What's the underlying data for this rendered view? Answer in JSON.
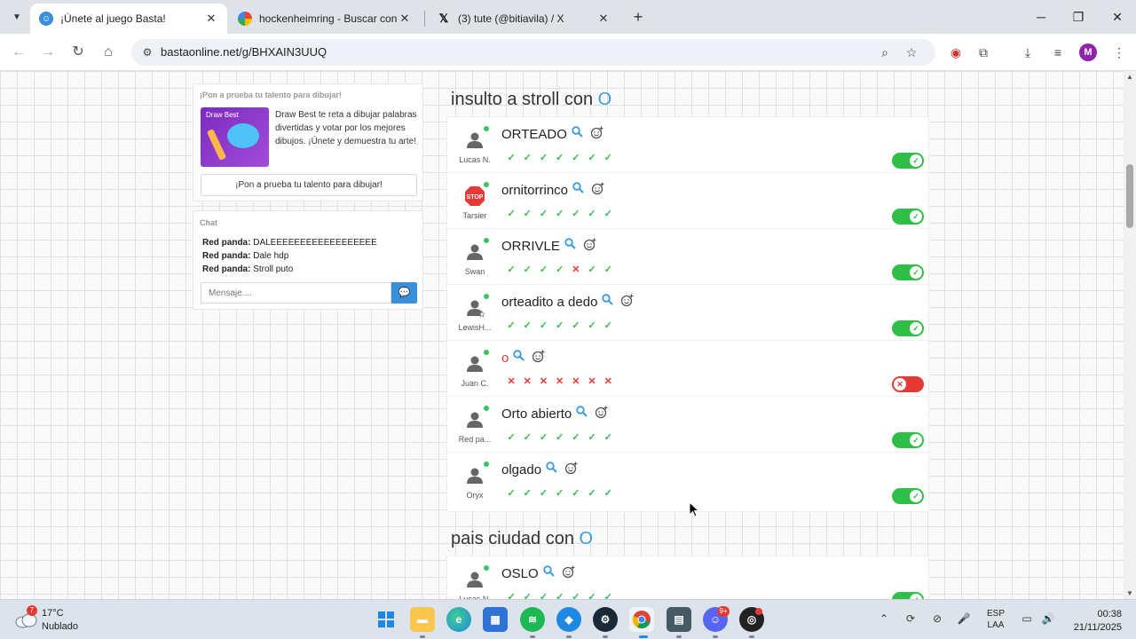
{
  "browser": {
    "tabs": [
      {
        "title": "¡Únete al juego Basta!",
        "favicon": "basta-favicon-icon",
        "active": true
      },
      {
        "title": "hockenheimring - Buscar con G",
        "favicon": "google-icon",
        "active": false
      },
      {
        "title": "(3) tute (@bitiavila) / X",
        "favicon": "x-icon",
        "active": false
      }
    ],
    "url": "bastaonline.net/g/BHXAIN3UUQ",
    "profile_initial": "M"
  },
  "promo": {
    "title": "¡Pon a prueba tu talento para dibujar!",
    "image_label": "Draw Best",
    "description": "Draw Best te reta a dibujar palabras divertidas y votar por los mejores dibujos. ¡Únete y demuestra tu arte!",
    "button_label": "¡Pon a prueba tu talento para dibujar!"
  },
  "chat": {
    "title": "Chat",
    "messages": [
      {
        "user": "Red panda:",
        "text": " DALEEEEEEEEEEEEEEEEEE"
      },
      {
        "user": "Red panda:",
        "text": " Dale hdp"
      },
      {
        "user": "Red panda:",
        "text": " Stroll puto"
      }
    ],
    "input_placeholder": "Mensaje...."
  },
  "categories": [
    {
      "title": "insulto a stroll con ",
      "letter": "O",
      "answers": [
        {
          "user": "Lucas N.",
          "answer": "ORTEADO",
          "valid": true,
          "votes": [
            "ok",
            "ok",
            "ok",
            "ok",
            "ok",
            "ok",
            "ok"
          ],
          "avatar": "user-icon"
        },
        {
          "user": "Tarsier",
          "answer": "ornitorrinco",
          "valid": true,
          "votes": [
            "ok",
            "ok",
            "ok",
            "ok",
            "ok",
            "ok",
            "ok"
          ],
          "avatar": "stop-sign-icon"
        },
        {
          "user": "Swan",
          "answer": "ORRIVLE",
          "valid": true,
          "votes": [
            "ok",
            "ok",
            "ok",
            "ok",
            "no",
            "ok",
            "ok"
          ],
          "avatar": "user-icon"
        },
        {
          "user": "LewisH...",
          "answer": "orteadito a dedo",
          "valid": true,
          "votes": [
            "ok",
            "ok",
            "ok",
            "ok",
            "ok",
            "ok",
            "ok"
          ],
          "avatar": "user-star-icon"
        },
        {
          "user": "Juan C.",
          "answer": "o",
          "valid": false,
          "votes": [
            "no",
            "no",
            "no",
            "no",
            "no",
            "no",
            "no"
          ],
          "avatar": "user-icon"
        },
        {
          "user": "Red pa...",
          "answer": "Orto abierto",
          "valid": true,
          "votes": [
            "ok",
            "ok",
            "ok",
            "ok",
            "ok",
            "ok",
            "ok"
          ],
          "avatar": "user-icon"
        },
        {
          "user": "Oryx",
          "answer": "olgado",
          "valid": true,
          "votes": [
            "ok",
            "ok",
            "ok",
            "ok",
            "ok",
            "ok",
            "ok"
          ],
          "avatar": "user-icon"
        }
      ]
    },
    {
      "title": "pais ciudad con ",
      "letter": "O",
      "answers": [
        {
          "user": "Lucas N.",
          "answer": "OSLO",
          "valid": true,
          "votes": [
            "ok",
            "ok",
            "ok",
            "ok",
            "ok",
            "ok",
            "ok"
          ],
          "avatar": "user-icon"
        }
      ]
    }
  ],
  "taskbar": {
    "weather_temp": "17°C",
    "weather_desc": "Nublado",
    "weather_badge": "7",
    "discord_badge": "9+",
    "apps": [
      "windows-start-icon",
      "file-explorer-icon",
      "edge-icon",
      "store-icon",
      "spotify-icon",
      "app-icon",
      "steam-icon",
      "chrome-icon",
      "calculator-icon",
      "discord-icon",
      "obs-icon"
    ],
    "lang_top": "ESP",
    "lang_bottom": "LAA",
    "time": "00:38",
    "date": "21/11/2025"
  },
  "colors": {
    "accent_blue": "#3a9be0",
    "valid_green": "#2fbe47",
    "invalid_red": "#e53935"
  }
}
